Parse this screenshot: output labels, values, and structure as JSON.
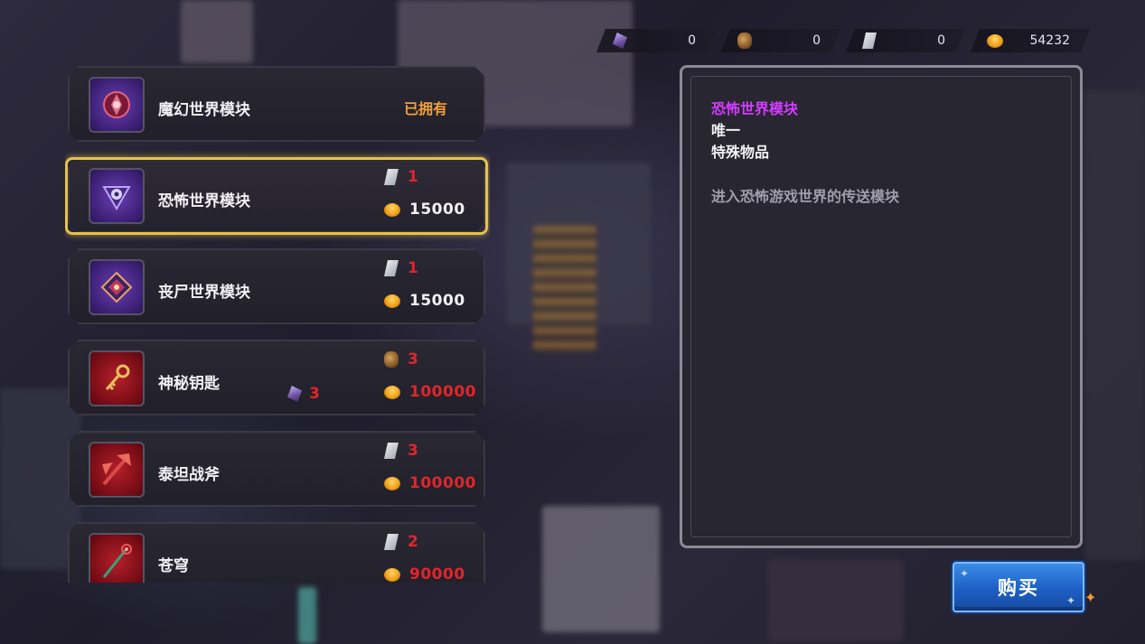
{
  "currencies": [
    {
      "icon": "crystal-shard-icon",
      "value": "0"
    },
    {
      "icon": "ore-icon",
      "value": "0"
    },
    {
      "icon": "scroll-icon",
      "value": "0"
    },
    {
      "icon": "gold-coin-icon",
      "value": "54232"
    }
  ],
  "shop": {
    "items": [
      {
        "name": "魔幻世界模块",
        "status": "已拥有",
        "icon": "fantasy-module-icon"
      },
      {
        "name": "恐怖世界模块",
        "icon": "horror-module-icon",
        "cost1_icon": "scroll-icon",
        "cost1": "1",
        "cost2_icon": "gold-coin-icon",
        "cost2": "15000"
      },
      {
        "name": "丧尸世界模块",
        "icon": "zombie-module-icon",
        "cost1_icon": "scroll-icon",
        "cost1": "1",
        "cost2_icon": "gold-coin-icon",
        "cost2": "15000"
      },
      {
        "name": "神秘钥匙",
        "icon": "key-icon",
        "extra_icon": "crystal-shard-icon",
        "extra_cost": "3",
        "cost1_icon": "ore-icon",
        "cost1": "3",
        "cost2_icon": "gold-coin-icon",
        "cost2": "100000"
      },
      {
        "name": "泰坦战斧",
        "icon": "battle-axe-icon",
        "cost1_icon": "scroll-icon",
        "cost1": "3",
        "cost2_icon": "gold-coin-icon",
        "cost2": "100000"
      },
      {
        "name": "苍穹",
        "icon": "staff-icon",
        "cost1_icon": "scroll-icon",
        "cost1": "2",
        "cost2_icon": "gold-coin-icon",
        "cost2": "90000"
      }
    ]
  },
  "detail": {
    "name": "恐怖世界模块",
    "rarity": "唯一",
    "type": "特殊物品",
    "description": "进入恐怖游戏世界的传送模块"
  },
  "buy_button": {
    "label": "购买"
  },
  "colors": {
    "selected_frame": "#e6c24a",
    "owned_text": "#f3a03a",
    "insufficient_cost": "#e0262a",
    "rarity_name": "#d33cff",
    "buy_button": "#1e5fc4"
  }
}
